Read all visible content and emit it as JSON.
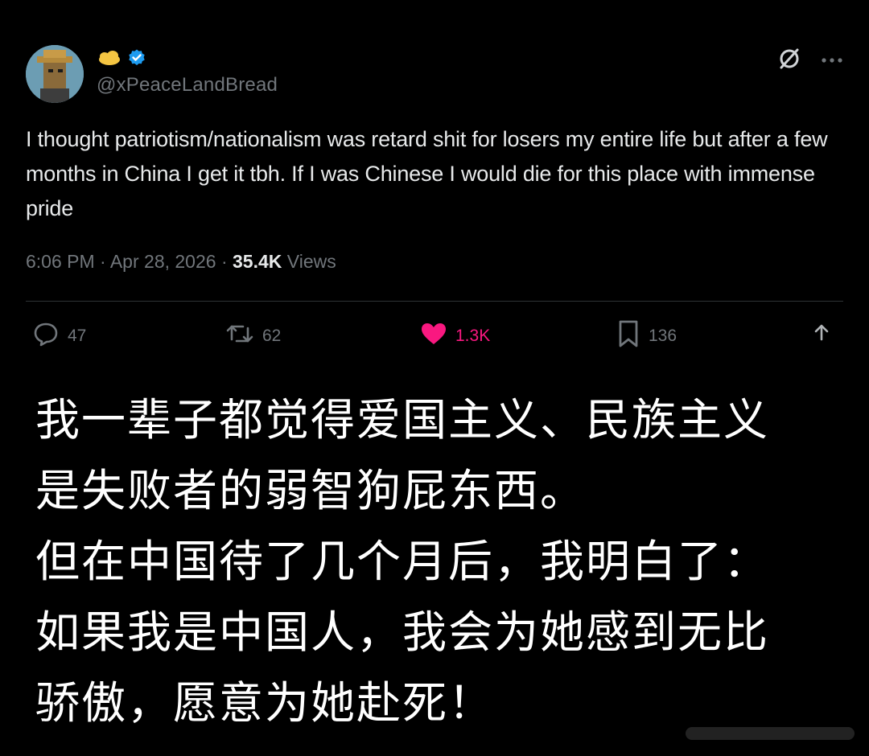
{
  "tweet": {
    "handle": "@xPeaceLandBread",
    "text": "I thought patriotism/nationalism was retard shit for losers my entire life but after a few months in China I get it tbh. If I was Chinese I would die for this place with immense pride",
    "time": "6:06 PM",
    "separator": "·",
    "date": "Apr 28, 2026",
    "views_count": "35.4K",
    "views_label": "Views",
    "actions": {
      "replies": "47",
      "reposts": "62",
      "likes": "1.3K",
      "bookmarks": "136"
    },
    "icons": {
      "badge": "cloud-badge-icon",
      "verified": "verified-check-icon",
      "grok": "grok-icon",
      "more": "more-icon",
      "reply": "reply-icon",
      "repost": "repost-icon",
      "like": "heart-icon",
      "bookmark": "bookmark-icon",
      "share": "share-icon"
    },
    "colors": {
      "like": "#f91880",
      "verified": "#1d9bf0",
      "muted": "#71767b",
      "text": "#e7e9ea"
    }
  },
  "translation": {
    "lines": [
      "我一辈子都觉得爱国主义、民族主义",
      "是失败者的弱智狗屁东西。",
      "但在中国待了几个月后，我明白了：",
      "如果我是中国人，我会为她感到无比",
      "骄傲，愿意为她赴死！"
    ]
  }
}
